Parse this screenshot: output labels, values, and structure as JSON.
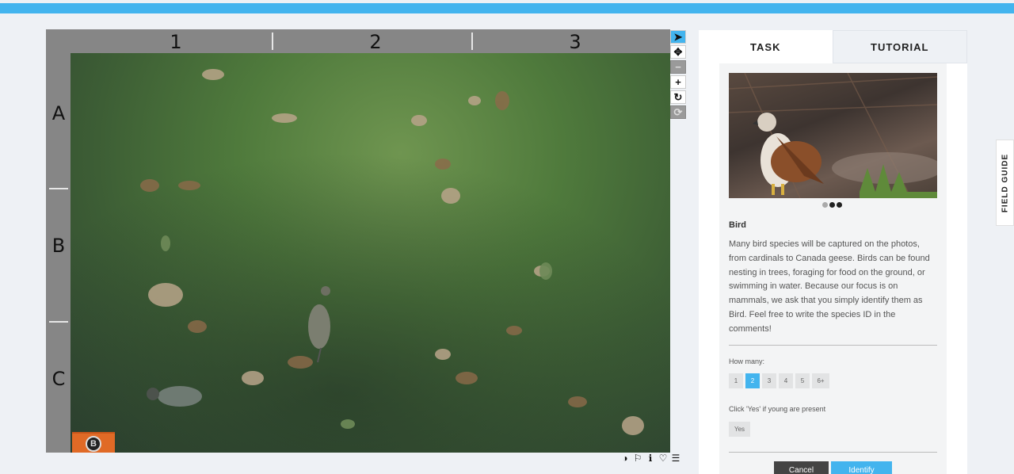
{
  "viewer": {
    "columns": [
      "1",
      "2",
      "3"
    ],
    "rows": [
      "A",
      "B",
      "C"
    ],
    "camera_logo": "B"
  },
  "tools": [
    {
      "name": "pointer",
      "icon": "cursor-icon",
      "glyph": "➤",
      "active": true
    },
    {
      "name": "pan",
      "icon": "move-icon",
      "glyph": "✥",
      "active": false
    },
    {
      "name": "zoom-out",
      "icon": "minus-icon",
      "glyph": "−",
      "active": false
    },
    {
      "name": "zoom-in",
      "icon": "plus-icon",
      "glyph": "+",
      "active": false
    },
    {
      "name": "rotate",
      "icon": "rotate-icon",
      "glyph": "↻",
      "active": false
    },
    {
      "name": "reset",
      "icon": "refresh-icon",
      "glyph": "⟳",
      "active": false
    }
  ],
  "meta_tools": [
    {
      "icon": "contrast-icon",
      "glyph": "◑"
    },
    {
      "icon": "flag-icon",
      "glyph": "⚐"
    },
    {
      "icon": "info-icon",
      "glyph": "ℹ"
    },
    {
      "icon": "heart-icon",
      "glyph": "♡"
    },
    {
      "icon": "list-icon",
      "glyph": "☰"
    }
  ],
  "tabs": {
    "task": "TASK",
    "tutorial": "TUTORIAL"
  },
  "species": {
    "name": "Bird",
    "description": "Many bird species will be captured on the photos, from cardinals to Canada geese. Birds can be found nesting in trees, foraging for food on the ground, or swimming in water. Because our focus is on mammals, we ask that you simply identify them as Bird. Feel free to write the species ID in the comments!"
  },
  "how_many": {
    "label": "How many:",
    "options": [
      "1",
      "2",
      "3",
      "4",
      "5",
      "6+"
    ],
    "selected": "2"
  },
  "young": {
    "label": "Click 'Yes' if young are present",
    "yes_label": "Yes"
  },
  "actions": {
    "cancel": "Cancel",
    "identify": "Identify"
  },
  "field_guide": "FIELD GUIDE",
  "colors": {
    "accent": "#43b4ee",
    "viewer_frame": "#868686"
  }
}
